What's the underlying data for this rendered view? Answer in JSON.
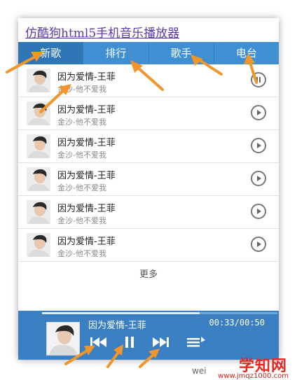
{
  "app": {
    "title": "仿酷狗html5手机音乐播放器"
  },
  "tabs": [
    {
      "label": "新歌"
    },
    {
      "label": "排行"
    },
    {
      "label": "歌手"
    },
    {
      "label": "电台"
    }
  ],
  "songs": [
    {
      "title": "因为爱情-王菲",
      "subtitle": "金沙-他不爱我",
      "state": "pause-icon"
    },
    {
      "title": "因为爱情-王菲",
      "subtitle": "金沙-他不爱我",
      "state": "play-icon"
    },
    {
      "title": "因为爱情-王菲",
      "subtitle": "金沙-他不爱我",
      "state": "play-icon"
    },
    {
      "title": "因为爱情-王菲",
      "subtitle": "金沙-他不爱我",
      "state": "play-icon"
    },
    {
      "title": "因为爱情-王菲",
      "subtitle": "金沙-他不爱我",
      "state": "play-icon"
    },
    {
      "title": "因为爱情-王菲",
      "subtitle": "金沙-他不爱我",
      "state": "play-icon"
    }
  ],
  "more_label": "更多",
  "player": {
    "song": "因为爱情-王菲",
    "time": "00:33/00:50",
    "progress": 0.67
  },
  "watermark": {
    "brand": "学知网",
    "url": "www.jmqz1000.com",
    "left_text": "wei"
  },
  "colors": {
    "tab_bar": "#3f8fd2",
    "player_bar": "#3a7fc1",
    "annotation_arrow": "#f0962b",
    "title_link": "#5b3aa6"
  }
}
